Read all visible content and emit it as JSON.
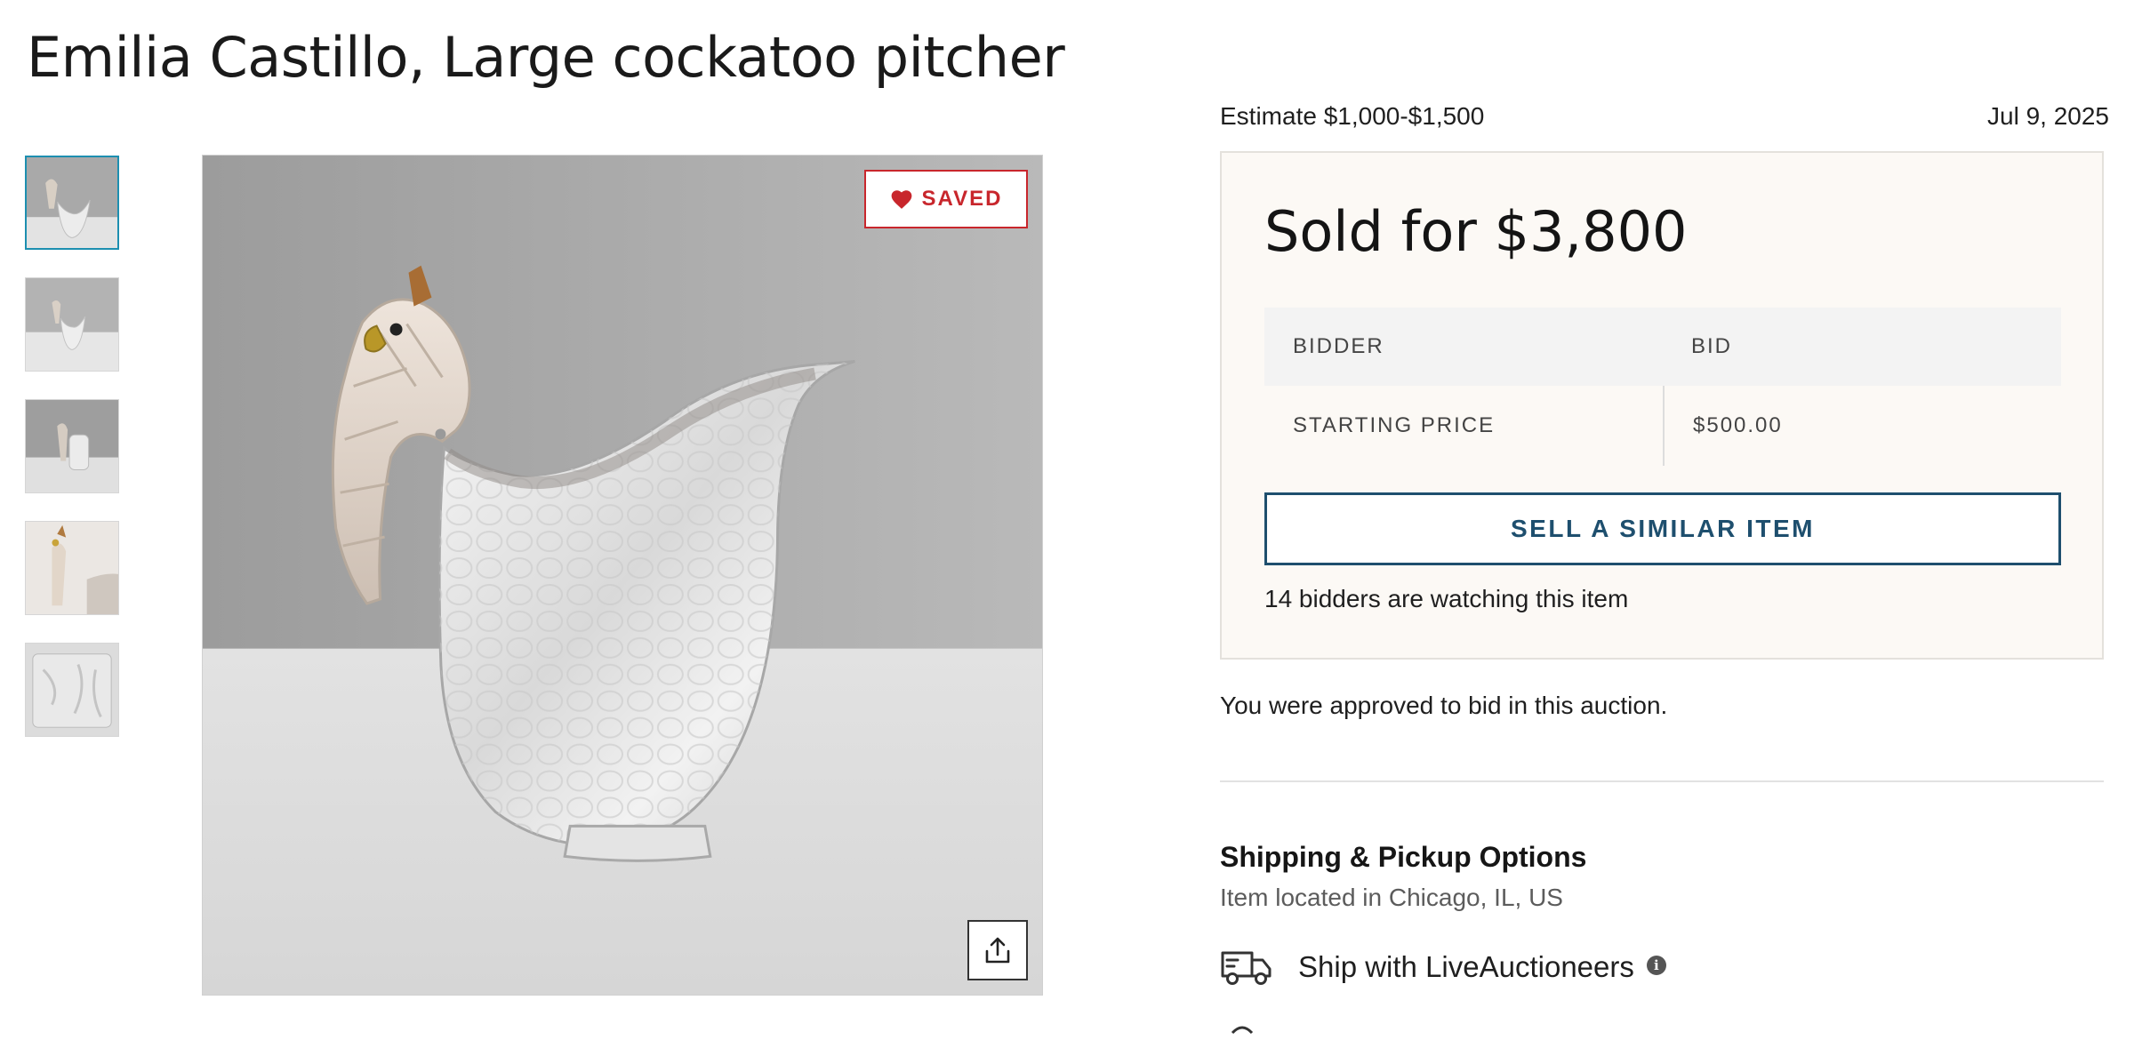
{
  "lot": {
    "title": "Emilia Castillo, Large cockatoo pitcher"
  },
  "gallery": {
    "thumbnails": [
      {
        "name": "thumbnail-1",
        "active": true
      },
      {
        "name": "thumbnail-2",
        "active": false
      },
      {
        "name": "thumbnail-3",
        "active": false
      },
      {
        "name": "thumbnail-4",
        "active": false
      },
      {
        "name": "thumbnail-5",
        "active": false
      }
    ],
    "saved_label": "SAVED",
    "saved_icon": "heart-icon",
    "share_icon": "share-icon"
  },
  "auction": {
    "estimate": "Estimate $1,000-$1,500",
    "date": "Jul 9, 2025",
    "sold_price": "Sold for $3,800",
    "table": {
      "headers": [
        "BIDDER",
        "BID"
      ],
      "rows": [
        {
          "bidder": "STARTING PRICE",
          "bid": "$500.00"
        }
      ]
    },
    "sell_button": "SELL A SIMILAR ITEM",
    "watching": "14 bidders are watching this item",
    "approved": "You were approved to bid in this auction."
  },
  "shipping": {
    "title": "Shipping & Pickup Options",
    "location": "Item located in Chicago, IL, US",
    "option_label": "Ship with LiveAuctioneers",
    "option_icon": "truck-icon",
    "info_icon": "info-icon",
    "info_glyph": "i"
  },
  "colors": {
    "accent_red": "#c8262c",
    "accent_blue": "#1e4f6e",
    "thumb_active": "#1d8fb0",
    "panel_bg": "#fcf9f5"
  }
}
